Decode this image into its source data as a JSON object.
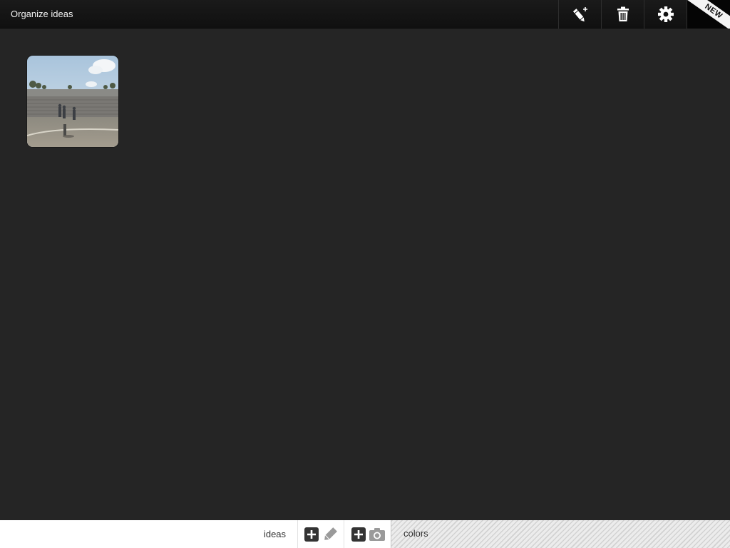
{
  "header": {
    "title": "Organize ideas",
    "buttons": {
      "new_idea_icon": "pencil-plus-icon",
      "trash_icon": "trash-icon",
      "settings_icon": "gear-icon"
    },
    "new_badge": "NEW"
  },
  "canvas": {
    "ideas": [
      {
        "type": "photo",
        "description_icon": "photo-thumbnail"
      }
    ]
  },
  "bottom_bar": {
    "ideas_tab": "ideas",
    "add_sketch_icons": [
      "plus-icon",
      "pencil-icon"
    ],
    "add_photo_icons": [
      "plus-icon",
      "camera-icon"
    ],
    "colors_tab": "colors"
  },
  "colors": {
    "background": "#252525",
    "topbar": "#111111",
    "bottombar": "#ffffff",
    "icon_dark": "#333333",
    "icon_light": "#9a9a9a"
  }
}
